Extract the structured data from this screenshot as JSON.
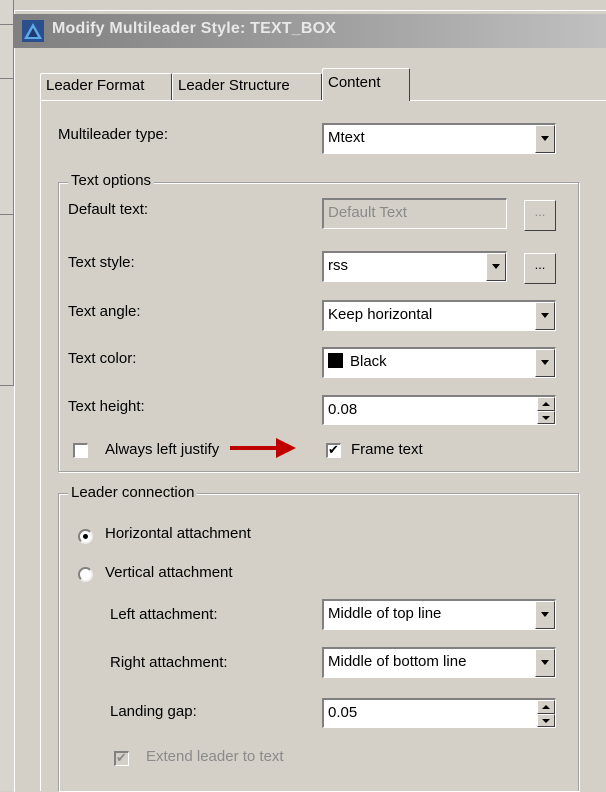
{
  "window": {
    "title": "Modify Multileader Style: TEXT_BOX",
    "icon": "autocad-icon"
  },
  "tabs": [
    {
      "label": "Leader Format",
      "active": false
    },
    {
      "label": "Leader Structure",
      "active": false
    },
    {
      "label": "Content",
      "active": true
    }
  ],
  "content": {
    "multileader_type": {
      "label": "Multileader type:",
      "value": "Mtext"
    },
    "text_options": {
      "legend": "Text options",
      "default_text": {
        "label": "Default text:",
        "value": "Default Text",
        "button": "..."
      },
      "text_style": {
        "label": "Text style:",
        "value": "rss",
        "button": "..."
      },
      "text_angle": {
        "label": "Text angle:",
        "value": "Keep horizontal"
      },
      "text_color": {
        "label": "Text color:",
        "value": "Black",
        "swatch": "#000000"
      },
      "text_height": {
        "label": "Text height:",
        "value": "0.08"
      },
      "always_left_justify": {
        "label": "Always left justify",
        "checked": false
      },
      "frame_text": {
        "label": "Frame text",
        "checked": true
      }
    },
    "leader_connection": {
      "legend": "Leader connection",
      "horizontal": {
        "label": "Horizontal attachment",
        "selected": true
      },
      "vertical": {
        "label": "Vertical attachment",
        "selected": false
      },
      "left_attachment": {
        "label": "Left attachment:",
        "value": "Middle of top line"
      },
      "right_attachment": {
        "label": "Right attachment:",
        "value": "Middle of bottom line"
      },
      "landing_gap": {
        "label": "Landing gap:",
        "value": "0.05"
      },
      "extend_leader": {
        "label": "Extend leader to text",
        "checked": true,
        "enabled": false
      }
    }
  },
  "annotation": {
    "arrow_color": "#c00000"
  }
}
